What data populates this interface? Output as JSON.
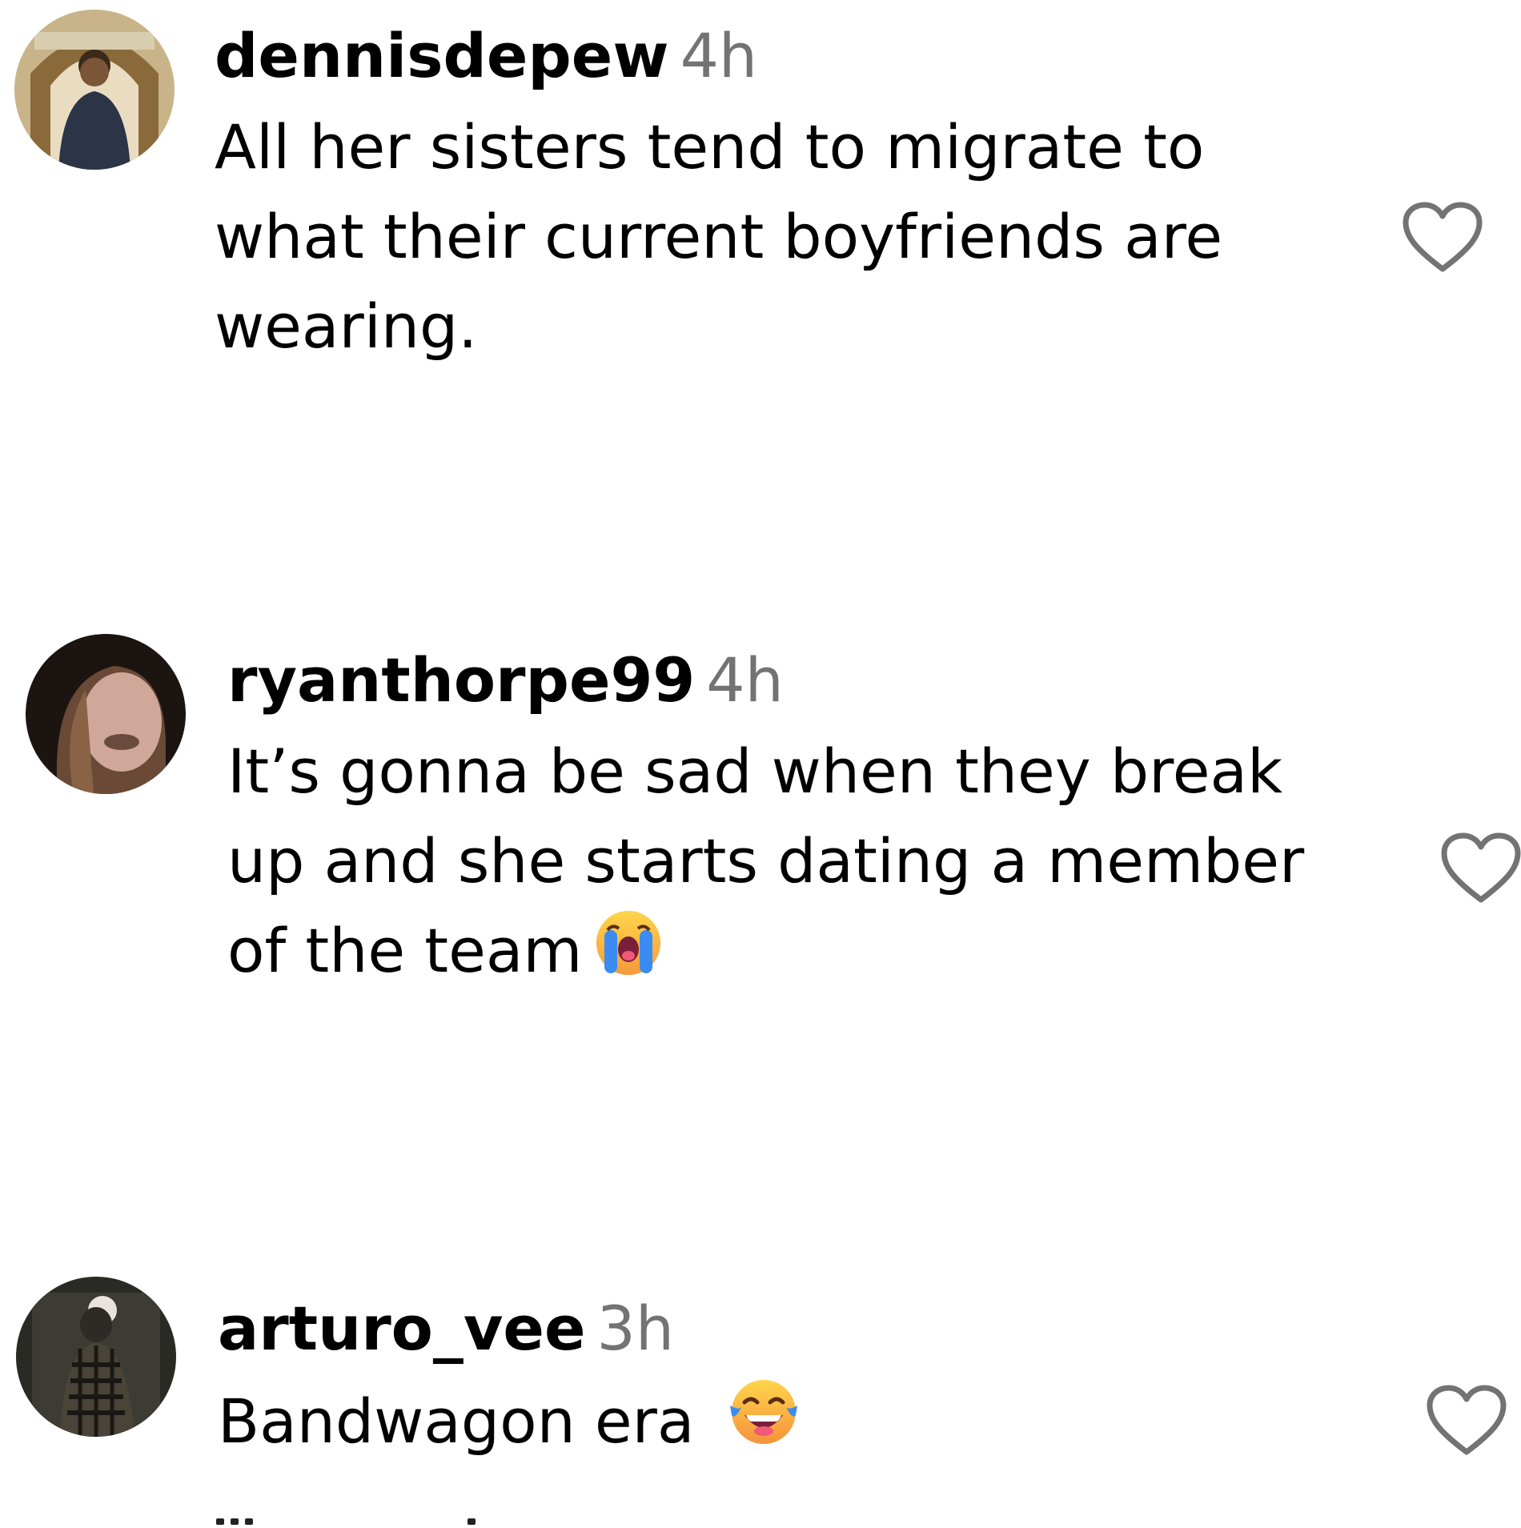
{
  "comments": [
    {
      "username": "dennisdepew",
      "time": "4h",
      "text": "All her sisters tend to migrate to\nwhat their current boyfriends are\nwearing.",
      "emoji": "",
      "like_icon": "heart-outline-icon"
    },
    {
      "username": "ryanthorpe99",
      "time": "4h",
      "text": "It’s gonna be sad when they break\nup and she starts dating a member\nof the team",
      "emoji": "loudly-crying-face",
      "like_icon": "heart-outline-icon"
    },
    {
      "username": "arturo_vee",
      "time": "3h",
      "text": "Bandwagon era",
      "emoji": "face-with-tears-of-joy",
      "like_icon": "heart-outline-icon"
    }
  ],
  "colors": {
    "username": "#000000",
    "timestamp": "#737373",
    "text": "#000000",
    "heart_outline": "#737373"
  }
}
